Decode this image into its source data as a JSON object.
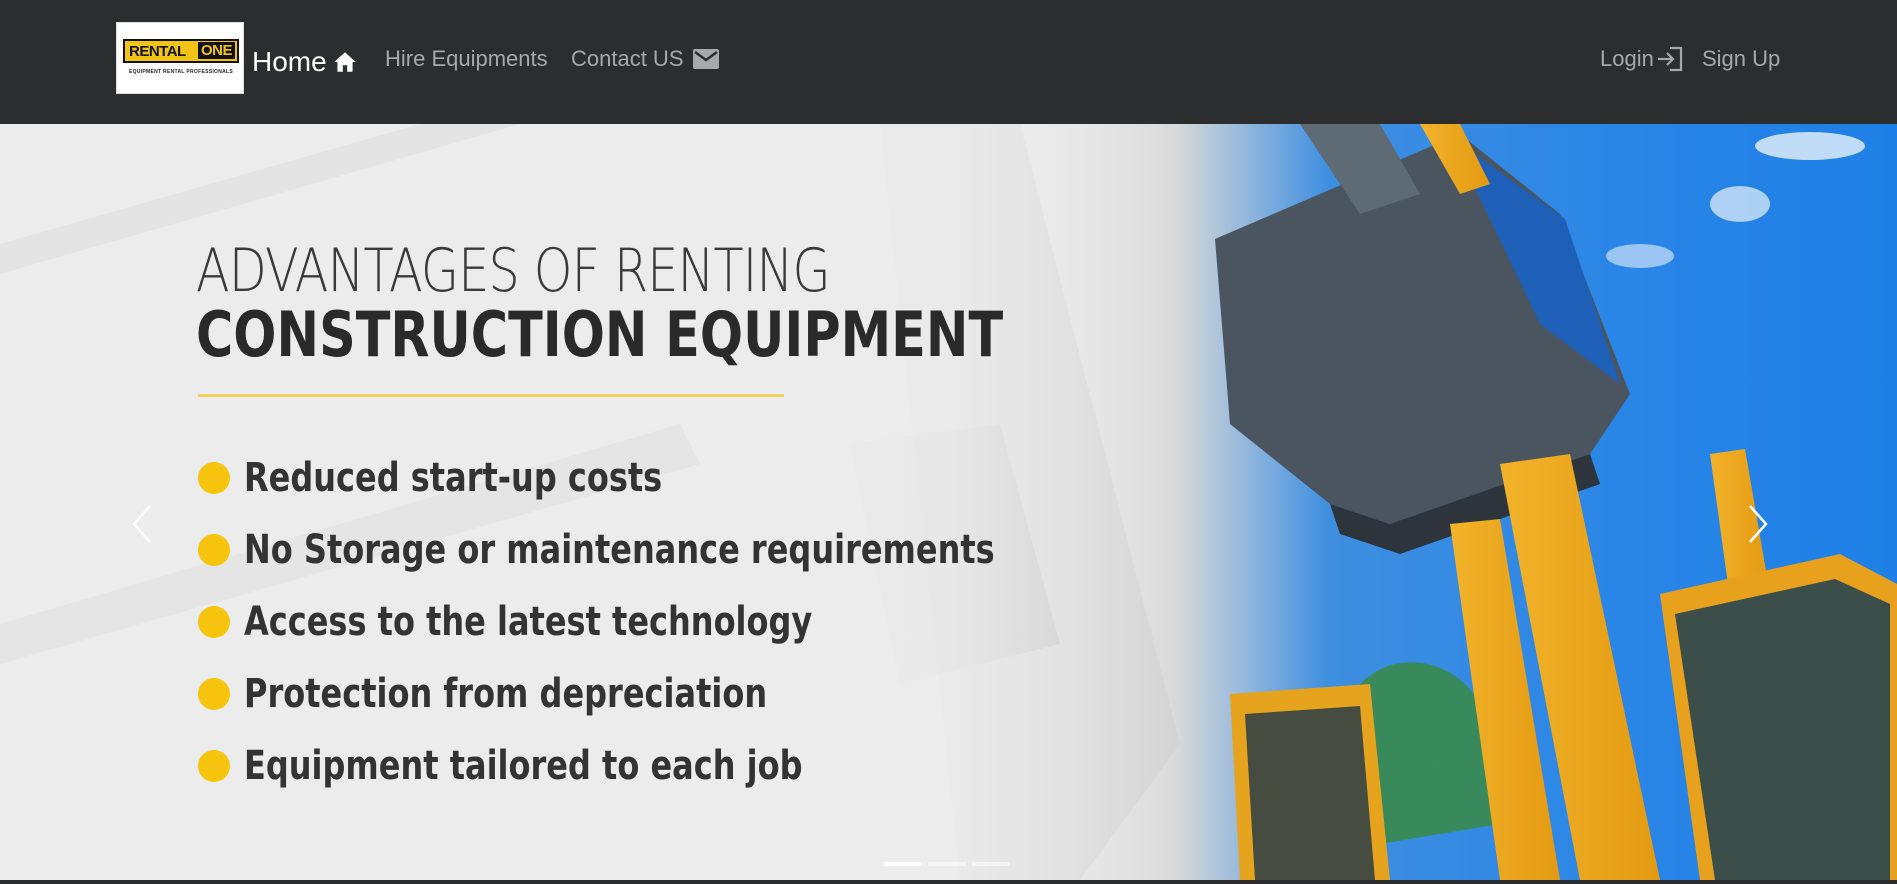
{
  "brand": {
    "logo_text_left": "RENTAL",
    "logo_text_right": "ONE",
    "logo_tagline": "EQUIPMENT RENTAL PROFESSIONALS"
  },
  "nav": {
    "home": "Home",
    "hire": "Hire Equipments",
    "contact": "Contact US",
    "login": "Login",
    "signup": "Sign Up"
  },
  "hero": {
    "title_line1": "ADVANTAGES OF RENTING",
    "title_line2": "CONSTRUCTION EQUIPMENT",
    "benefits": [
      "Reduced start-up costs",
      "No Storage or maintenance requirements",
      "Access to the latest technology",
      "Protection from depreciation",
      "Equipment tailored to each job"
    ],
    "active_slide": 1,
    "slide_count": 3
  },
  "colors": {
    "navbar": "#2c2d2f",
    "accent_yellow": "#f7c40d",
    "nav_text": "#a7a8aa",
    "sky_blue": "#2a86e6"
  },
  "icons": [
    "home-icon",
    "mail-icon",
    "login-icon",
    "chevron-left-icon",
    "chevron-right-icon"
  ]
}
